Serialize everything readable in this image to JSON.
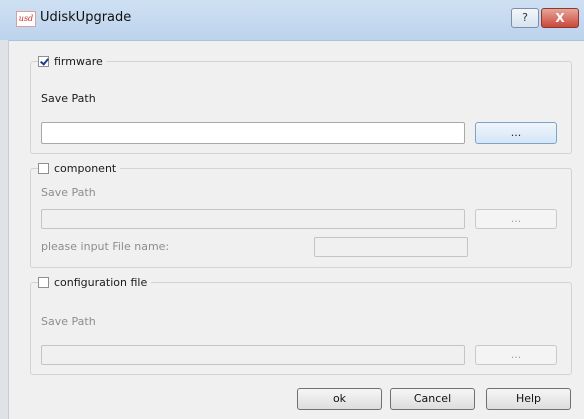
{
  "window": {
    "title": "UdiskUpgrade",
    "icon_text": "usd",
    "help_button": "?",
    "close_button": "X"
  },
  "firmware": {
    "checkbox_label": "firmware",
    "checked": true,
    "save_path_label": "Save Path",
    "save_path_value": "",
    "browse_label": "..."
  },
  "component": {
    "checkbox_label": "component",
    "checked": false,
    "save_path_label": "Save Path",
    "save_path_value": "",
    "browse_label": "...",
    "file_name_label": "please input File name:",
    "file_name_value": ""
  },
  "configuration": {
    "checkbox_label": "configuration file",
    "checked": false,
    "save_path_label": "Save Path",
    "save_path_value": "",
    "browse_label": "..."
  },
  "buttons": {
    "ok": "ok",
    "cancel": "Cancel",
    "help": "Help"
  }
}
